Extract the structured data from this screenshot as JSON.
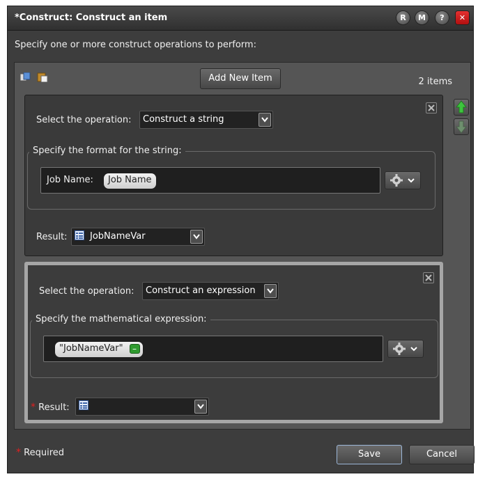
{
  "window": {
    "title": "*Construct: Construct an item",
    "buttons": [
      "R",
      "M",
      "?",
      "✕"
    ],
    "subtitle": "Specify one or more construct operations to perform:"
  },
  "toolbar": {
    "copy_icon": "copy-icon",
    "paste_icon": "paste-icon",
    "add_label": "Add New Item",
    "items_count": "2 items"
  },
  "items": [
    {
      "operation_label": "Select the operation:",
      "operation_value": "Construct a string",
      "group_label": "Specify the format for the string:",
      "editor_prefix": "Job Name:",
      "chip": "Job Name",
      "result_label": "Result:",
      "result_value": "JobNameVar"
    },
    {
      "operation_label": "Select the operation:",
      "operation_value": "Construct an expression",
      "group_label": "Specify the mathematical expression:",
      "chip": "\"JobNameVar\"",
      "chip_badge": "–",
      "result_label": "Result:",
      "result_value": "",
      "required": true
    }
  ],
  "footer": {
    "required_label": "Required",
    "save_label": "Save",
    "cancel_label": "Cancel"
  },
  "colors": {
    "close": "#c8201f",
    "up_arrow": "#3ec43e",
    "required_star": "#e02020",
    "badge": "#2f9a2f"
  }
}
